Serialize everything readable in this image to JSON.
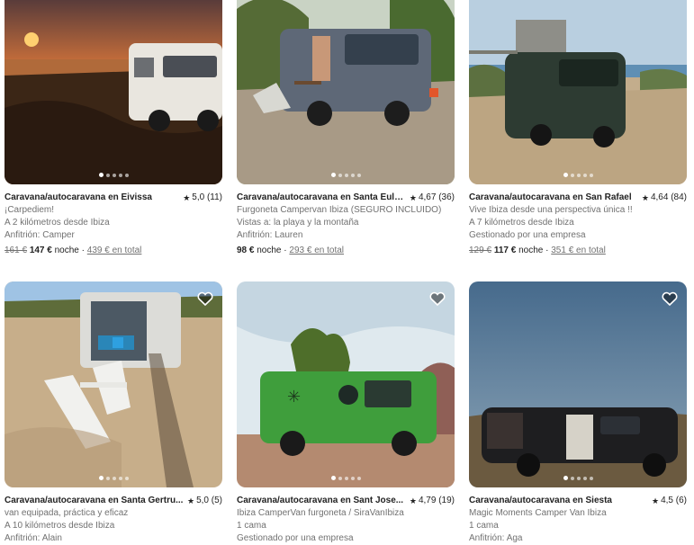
{
  "listings": [
    {
      "title": "Caravana/autocaravana en Eivissa",
      "rating": "5,0 (11)",
      "line1": "¡Carpediem!",
      "line2": "A 2 kilómetros desde Ibiza",
      "line3": "Anfitrión: Camper",
      "old_price": "161 €",
      "price": "147 €",
      "per": "noche",
      "sep": "·",
      "total": "439 € en total"
    },
    {
      "title": "Caravana/autocaravana en Santa Eulà...",
      "rating": "4,67 (36)",
      "line1": "Furgoneta Campervan Ibiza (SEGURO INCLUIDO)",
      "line2": "Vistas a: la playa y la montaña",
      "line3": "Anfitrión: Lauren",
      "old_price": "",
      "price": "98 €",
      "per": "noche",
      "sep": "·",
      "total": "293 € en total"
    },
    {
      "title": "Caravana/autocaravana en San Rafael",
      "rating": "4,64 (84)",
      "line1": "Vive Ibiza desde una perspectiva única !!",
      "line2": "A 7 kilómetros desde Ibiza",
      "line3": "Gestionado por una empresa",
      "old_price": "129 €",
      "price": "117 €",
      "per": "noche",
      "sep": "·",
      "total": "351 € en total"
    },
    {
      "title": "Caravana/autocaravana en Santa Gertru...",
      "rating": "5,0 (5)",
      "line1": "van equipada, práctica y eficaz",
      "line2": "A 10 kilómetros desde Ibiza",
      "line3": "Anfitrión: Alain"
    },
    {
      "title": "Caravana/autocaravana en Sant Jose...",
      "rating": "4,79 (19)",
      "line1": "Ibiza CamperVan furgoneta / SiraVanIbiza",
      "line2": "1 cama",
      "line3": "Gestionado por una empresa"
    },
    {
      "title": "Caravana/autocaravana en Siesta",
      "rating": "4,5 (6)",
      "line1": "Magic Moments Camper Van Ibiza",
      "line2": "1 cama",
      "line3": "Anfitrión: Aga"
    }
  ],
  "icons": {
    "favorite": "heart-icon",
    "rating": "star-icon"
  },
  "colors": {
    "text": "#222222",
    "muted": "#717171"
  }
}
